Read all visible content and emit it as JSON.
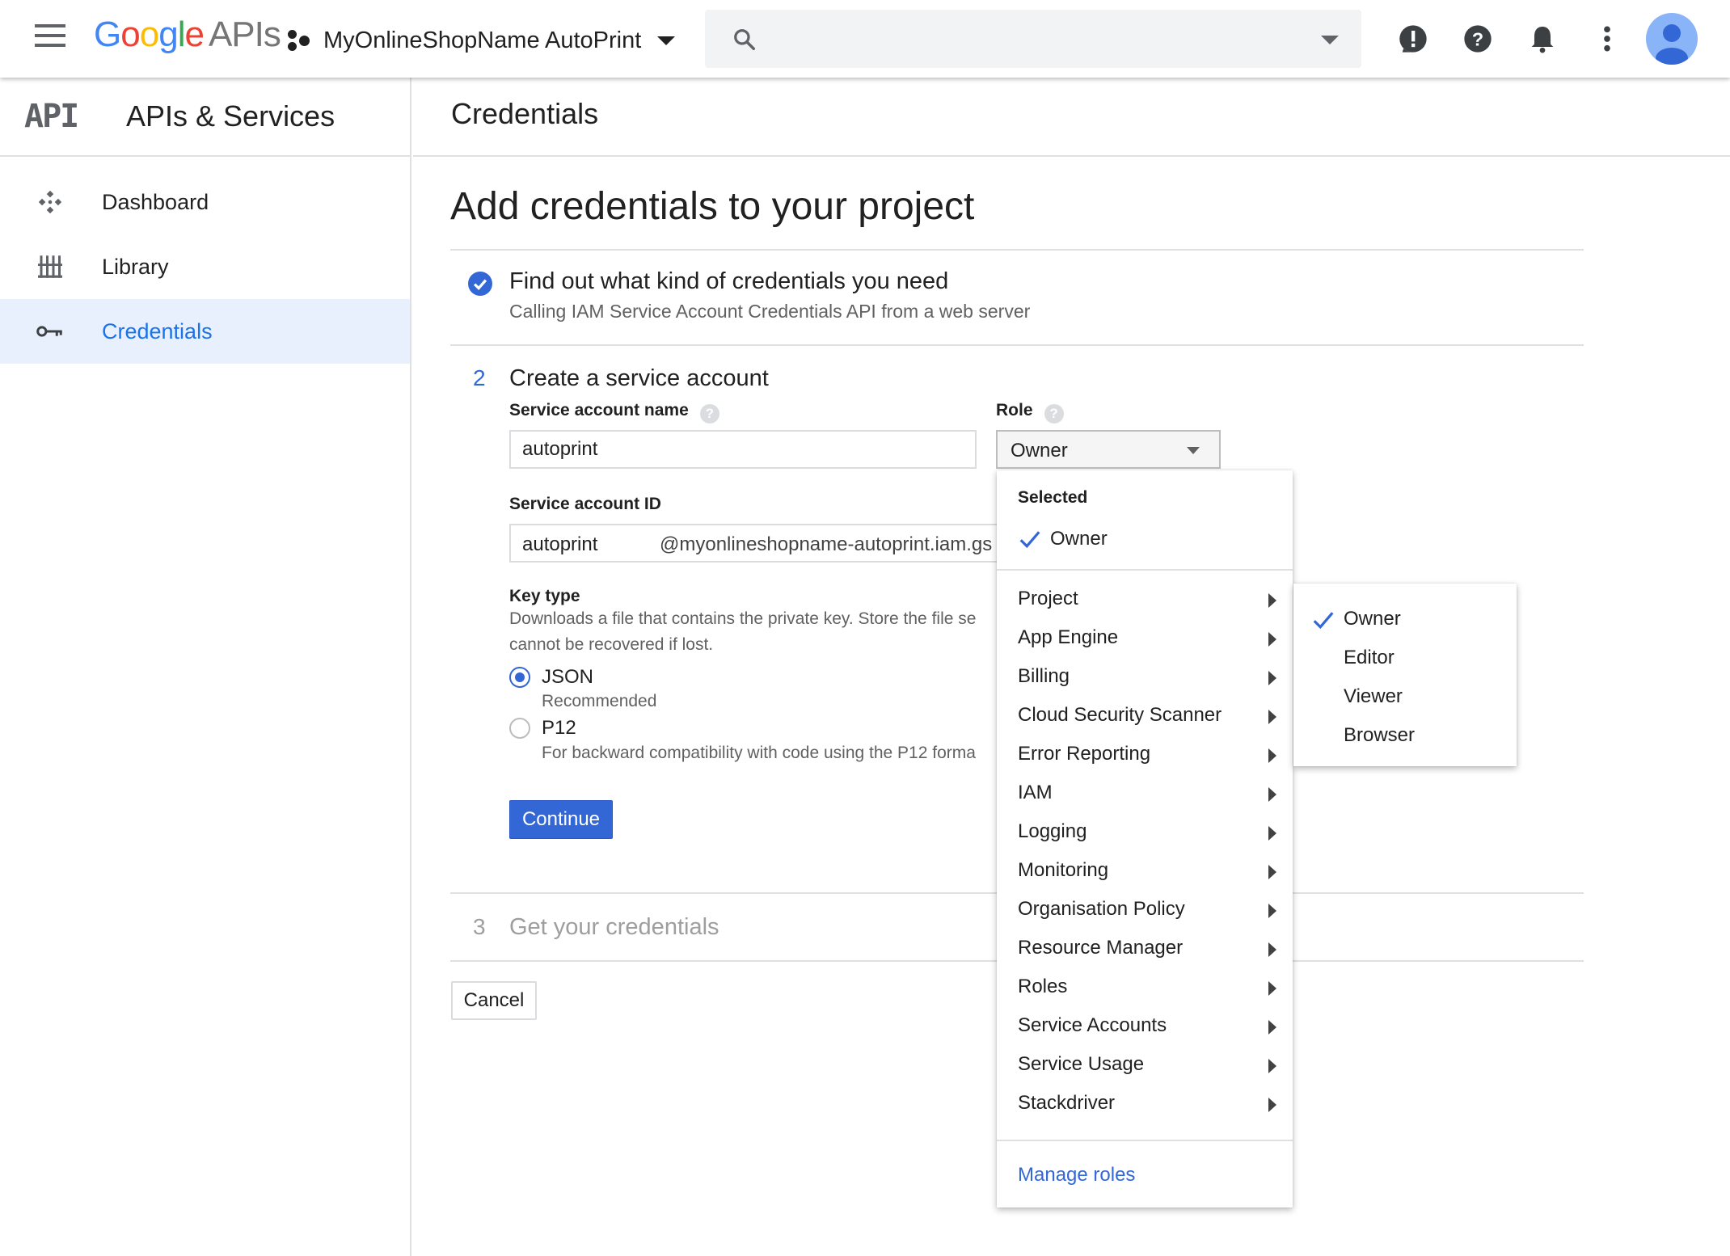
{
  "topbar": {
    "logo_google": [
      "G",
      "o",
      "o",
      "g",
      "l",
      "e"
    ],
    "logo_apis": "APIs",
    "project_name": "MyOnlineShopName AutoPrint",
    "search_placeholder": ""
  },
  "sidebar": {
    "title": "APIs & Services",
    "api_mark": "API",
    "items": [
      {
        "label": "Dashboard",
        "icon": "dashboard-icon",
        "active": false
      },
      {
        "label": "Library",
        "icon": "library-icon",
        "active": false
      },
      {
        "label": "Credentials",
        "icon": "key-icon",
        "active": true
      }
    ]
  },
  "header": {
    "title": "Credentials"
  },
  "main": {
    "page_title": "Add credentials to your project",
    "step1": {
      "title": "Find out what kind of credentials you need",
      "subtitle": "Calling IAM Service Account Credentials API from a web server"
    },
    "step2": {
      "number": "2",
      "title": "Create a service account",
      "name_label": "Service account name",
      "name_value": "autoprint",
      "role_label": "Role",
      "role_value": "Owner",
      "id_label": "Service account ID",
      "id_value": "autoprint",
      "id_suffix": "@myonlineshopname-autoprint.iam.gs",
      "key_type_label": "Key type",
      "key_type_desc_line1": "Downloads a file that contains the private key. Store the file se",
      "key_type_desc_line2": "cannot be recovered if lost.",
      "options": [
        {
          "label": "JSON",
          "desc": "Recommended",
          "selected": true
        },
        {
          "label": "P12",
          "desc": "For backward compatibility with code using the P12 forma",
          "selected": false
        }
      ],
      "continue_label": "Continue"
    },
    "step3": {
      "number": "3",
      "title": "Get your credentials"
    },
    "cancel_label": "Cancel"
  },
  "role_menu": {
    "selected_label": "Selected",
    "selected_item": "Owner",
    "categories": [
      "Project",
      "App Engine",
      "Billing",
      "Cloud Security Scanner",
      "Error Reporting",
      "IAM",
      "Logging",
      "Monitoring",
      "Organisation Policy",
      "Resource Manager",
      "Roles",
      "Service Accounts",
      "Service Usage",
      "Stackdriver"
    ],
    "manage_label": "Manage roles",
    "submenu": [
      {
        "label": "Owner",
        "checked": true
      },
      {
        "label": "Editor",
        "checked": false
      },
      {
        "label": "Viewer",
        "checked": false
      },
      {
        "label": "Browser",
        "checked": false
      }
    ]
  },
  "colors": {
    "accent": "#3367d6",
    "active_bg": "#e8f0fe",
    "active_text": "#1a73e8"
  }
}
